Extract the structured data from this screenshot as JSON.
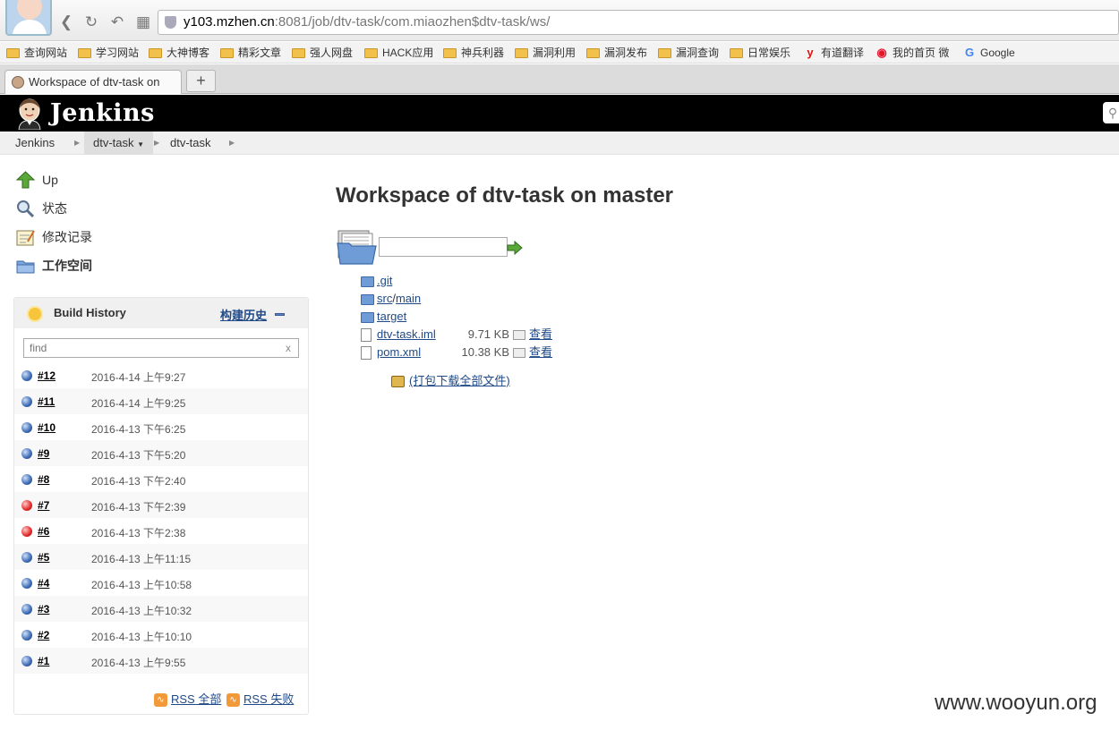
{
  "browser": {
    "url_host": "y103.mzhen.cn",
    "url_rest": ":8081/job/dtv-task/com.miaozhen$dtv-task/ws/",
    "bookmarks": [
      "查询网站",
      "学习网站",
      "大神博客",
      "精彩文章",
      "强人网盘",
      "HACK应用",
      "神兵利器",
      "漏洞利用",
      "漏洞发布",
      "漏洞查询",
      "日常娱乐",
      "有道翻译",
      "我的首页 微",
      "Google"
    ],
    "tab_title": "Workspace of dtv-task on",
    "new_tab": "+"
  },
  "jenkins": {
    "logo": "Jenkins",
    "breadcrumb": [
      "Jenkins",
      "dtv-task",
      "dtv-task"
    ]
  },
  "tasks": [
    {
      "label": "Up",
      "icon": "up-arrow-icon"
    },
    {
      "label": "状态",
      "icon": "magnifier-icon"
    },
    {
      "label": "修改记录",
      "icon": "notepad-icon"
    },
    {
      "label": "工作空间",
      "icon": "folder-icon"
    }
  ],
  "build_history": {
    "title": "Build History",
    "trend_link": "构建历史",
    "filter_placeholder": "find",
    "clear": "x",
    "builds": [
      {
        "num": "#12",
        "date": "2016-4-14 上午9:27",
        "status": "blue"
      },
      {
        "num": "#11",
        "date": "2016-4-14 上午9:25",
        "status": "blue"
      },
      {
        "num": "#10",
        "date": "2016-4-13 下午6:25",
        "status": "blue"
      },
      {
        "num": "#9",
        "date": "2016-4-13 下午5:20",
        "status": "blue"
      },
      {
        "num": "#8",
        "date": "2016-4-13 下午2:40",
        "status": "blue"
      },
      {
        "num": "#7",
        "date": "2016-4-13 下午2:39",
        "status": "red"
      },
      {
        "num": "#6",
        "date": "2016-4-13 下午2:38",
        "status": "red"
      },
      {
        "num": "#5",
        "date": "2016-4-13 上午11:15",
        "status": "blue"
      },
      {
        "num": "#4",
        "date": "2016-4-13 上午10:58",
        "status": "blue"
      },
      {
        "num": "#3",
        "date": "2016-4-13 上午10:32",
        "status": "blue"
      },
      {
        "num": "#2",
        "date": "2016-4-13 上午10:10",
        "status": "blue"
      },
      {
        "num": "#1",
        "date": "2016-4-13 上午9:55",
        "status": "blue"
      }
    ],
    "rss_all": "RSS 全部",
    "rss_failed": "RSS 失败"
  },
  "workspace": {
    "title": "Workspace of dtv-task on master",
    "entries": [
      {
        "type": "folder",
        "name": ".git"
      },
      {
        "type": "folder",
        "name_parts": [
          "src",
          "/",
          "main"
        ]
      },
      {
        "type": "folder",
        "name": "target"
      },
      {
        "type": "file",
        "name": "dtv-task.iml",
        "size": "9.71 KB",
        "view": "查看"
      },
      {
        "type": "file",
        "name": "pom.xml",
        "size": "10.38 KB",
        "view": "查看"
      }
    ],
    "zip_link": "(打包下载全部文件)"
  },
  "colors": {
    "link": "#204A87",
    "header_bg": "#000000",
    "success": "#3a69b5",
    "failure": "#e22828"
  },
  "watermark": "www.wooyun.org"
}
